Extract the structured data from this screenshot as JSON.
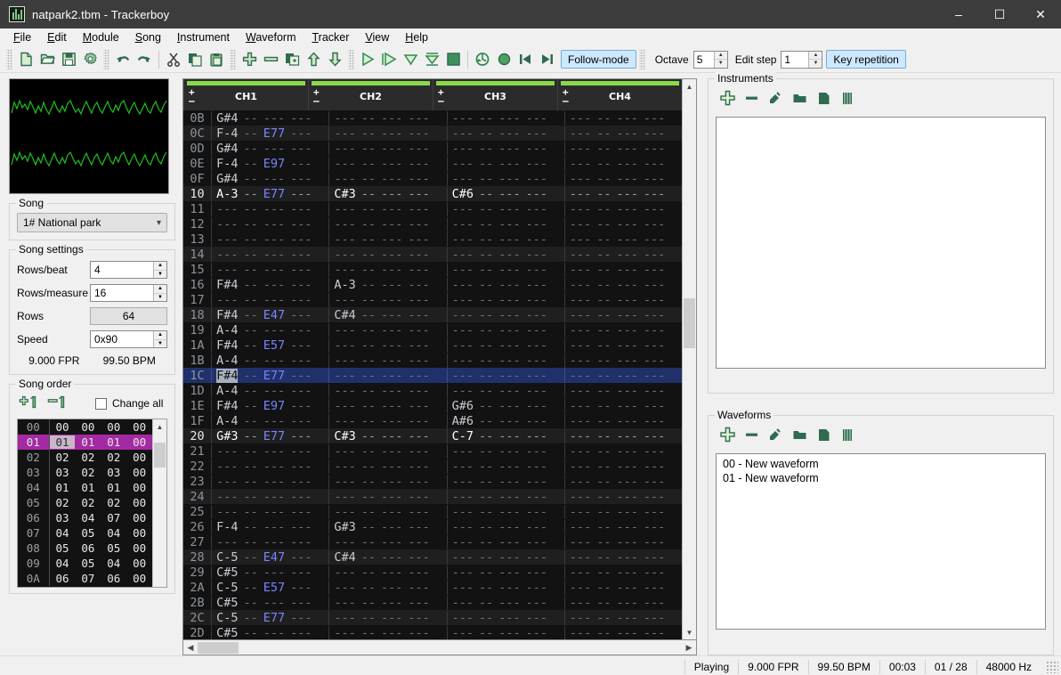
{
  "window": {
    "title": "natpark2.tbm - Trackerboy",
    "app_icon": "trackerboy-icon",
    "minimize": "–",
    "maximize": "☐",
    "close": "✕"
  },
  "menubar": {
    "items": [
      {
        "label": "File",
        "mnemonic": "F"
      },
      {
        "label": "Edit",
        "mnemonic": "E"
      },
      {
        "label": "Module",
        "mnemonic": "M"
      },
      {
        "label": "Song",
        "mnemonic": "S"
      },
      {
        "label": "Instrument",
        "mnemonic": "I"
      },
      {
        "label": "Waveform",
        "mnemonic": "W"
      },
      {
        "label": "Tracker",
        "mnemonic": "T"
      },
      {
        "label": "View",
        "mnemonic": "V"
      },
      {
        "label": "Help",
        "mnemonic": "H"
      }
    ]
  },
  "toolbar": {
    "group_file": [
      "new-icon",
      "open-icon",
      "save-icon",
      "settings-icon"
    ],
    "group_edit": [
      "undo-icon",
      "redo-icon"
    ],
    "group_clipboard": [
      "cut-icon",
      "copy-icon",
      "paste-icon"
    ],
    "group_order": [
      "add-order-icon",
      "remove-order-icon",
      "duplicate-order-icon",
      "move-up-icon",
      "move-down-icon"
    ],
    "group_transport": [
      "play-icon",
      "play-pattern-icon",
      "play-from-cursor-icon",
      "play-row-icon",
      "stop-icon"
    ],
    "group_record": [
      "loop-pattern-icon",
      "record-icon",
      "prev-pattern-icon",
      "next-pattern-icon"
    ],
    "follow_mode_label": "Follow-mode",
    "octave_label": "Octave",
    "octave_value": "5",
    "edit_step_label": "Edit step",
    "edit_step_value": "1",
    "key_repetition_label": "Key repetition"
  },
  "left_dock": {
    "scope_name": "audio-scope",
    "song_group_label": "Song",
    "song_selected": "1# National park",
    "song_settings_label": "Song settings",
    "fields": [
      {
        "label": "Rows/beat",
        "value": "4",
        "type": "spin"
      },
      {
        "label": "Rows/measure",
        "value": "16",
        "type": "spin"
      },
      {
        "label": "Rows",
        "value": "64",
        "type": "readonly"
      },
      {
        "label": "Speed",
        "value": "0x90",
        "type": "spin"
      }
    ],
    "fpr": "9.000 FPR",
    "bpm": "99.50 BPM",
    "song_order_label": "Song order",
    "order_add_icon": "add-order-row-icon",
    "order_remove_icon": "remove-order-row-icon",
    "change_all_label": "Change all",
    "change_all_checked": false,
    "order_rows": [
      {
        "index": "00",
        "cells": [
          "00",
          "00",
          "00",
          "00"
        ]
      },
      {
        "index": "01",
        "cells": [
          "01",
          "01",
          "01",
          "00"
        ]
      },
      {
        "index": "02",
        "cells": [
          "02",
          "02",
          "02",
          "00"
        ]
      },
      {
        "index": "03",
        "cells": [
          "03",
          "02",
          "03",
          "00"
        ]
      },
      {
        "index": "04",
        "cells": [
          "01",
          "01",
          "01",
          "00"
        ]
      },
      {
        "index": "05",
        "cells": [
          "02",
          "02",
          "02",
          "00"
        ]
      },
      {
        "index": "06",
        "cells": [
          "03",
          "04",
          "07",
          "00"
        ]
      },
      {
        "index": "07",
        "cells": [
          "04",
          "05",
          "04",
          "00"
        ]
      },
      {
        "index": "08",
        "cells": [
          "05",
          "06",
          "05",
          "00"
        ]
      },
      {
        "index": "09",
        "cells": [
          "04",
          "05",
          "04",
          "00"
        ]
      },
      {
        "index": "0A",
        "cells": [
          "06",
          "07",
          "06",
          "00"
        ]
      }
    ],
    "order_selected_row": 1,
    "order_selected_cell": 0
  },
  "pattern": {
    "channels": [
      "CH1",
      "CH2",
      "CH3",
      "CH4"
    ],
    "plus_glyph": "+",
    "minus_glyph": "–",
    "cursor_row": "1C",
    "rows": [
      {
        "index": "0B",
        "cells": [
          {
            "note": "G#4"
          },
          {},
          {},
          {}
        ]
      },
      {
        "index": "0C",
        "cells": [
          {
            "note": "F-4",
            "fx": "E77"
          },
          {},
          {},
          {}
        ]
      },
      {
        "index": "0D",
        "cells": [
          {
            "note": "G#4"
          },
          {},
          {},
          {}
        ]
      },
      {
        "index": "0E",
        "cells": [
          {
            "note": "F-4",
            "fx": "E97"
          },
          {},
          {},
          {}
        ]
      },
      {
        "index": "0F",
        "cells": [
          {
            "note": "G#4"
          },
          {},
          {},
          {}
        ]
      },
      {
        "index": "10",
        "cells": [
          {
            "note": "A-3",
            "fx": "E77"
          },
          {
            "note": "C#3"
          },
          {
            "note": "C#6"
          },
          {}
        ]
      },
      {
        "index": "11",
        "cells": [
          {},
          {},
          {},
          {}
        ]
      },
      {
        "index": "12",
        "cells": [
          {},
          {},
          {},
          {}
        ]
      },
      {
        "index": "13",
        "cells": [
          {},
          {},
          {},
          {}
        ]
      },
      {
        "index": "14",
        "cells": [
          {},
          {},
          {},
          {}
        ]
      },
      {
        "index": "15",
        "cells": [
          {},
          {},
          {},
          {}
        ]
      },
      {
        "index": "16",
        "cells": [
          {
            "note": "F#4"
          },
          {
            "note": "A-3"
          },
          {},
          {}
        ]
      },
      {
        "index": "17",
        "cells": [
          {},
          {},
          {},
          {}
        ]
      },
      {
        "index": "18",
        "cells": [
          {
            "note": "F#4",
            "fx": "E47"
          },
          {
            "note": "C#4"
          },
          {},
          {}
        ]
      },
      {
        "index": "19",
        "cells": [
          {
            "note": "A-4"
          },
          {},
          {},
          {}
        ]
      },
      {
        "index": "1A",
        "cells": [
          {
            "note": "F#4",
            "fx": "E57"
          },
          {},
          {},
          {}
        ]
      },
      {
        "index": "1B",
        "cells": [
          {
            "note": "A-4"
          },
          {},
          {},
          {}
        ]
      },
      {
        "index": "1C",
        "cells": [
          {
            "note": "F#4",
            "fx": "E77"
          },
          {},
          {},
          {}
        ]
      },
      {
        "index": "1D",
        "cells": [
          {
            "note": "A-4"
          },
          {},
          {},
          {}
        ]
      },
      {
        "index": "1E",
        "cells": [
          {
            "note": "F#4",
            "fx": "E97"
          },
          {},
          {
            "note": "G#6"
          },
          {}
        ]
      },
      {
        "index": "1F",
        "cells": [
          {
            "note": "A-4"
          },
          {},
          {
            "note": "A#6"
          },
          {}
        ]
      },
      {
        "index": "20",
        "cells": [
          {
            "note": "G#3",
            "fx": "E77"
          },
          {
            "note": "C#3"
          },
          {
            "note": "C-7"
          },
          {}
        ]
      },
      {
        "index": "21",
        "cells": [
          {},
          {},
          {},
          {}
        ]
      },
      {
        "index": "22",
        "cells": [
          {},
          {},
          {},
          {}
        ]
      },
      {
        "index": "23",
        "cells": [
          {},
          {},
          {},
          {}
        ]
      },
      {
        "index": "24",
        "cells": [
          {},
          {},
          {},
          {}
        ]
      },
      {
        "index": "25",
        "cells": [
          {},
          {},
          {},
          {}
        ]
      },
      {
        "index": "26",
        "cells": [
          {
            "note": "F-4"
          },
          {
            "note": "G#3"
          },
          {},
          {}
        ]
      },
      {
        "index": "27",
        "cells": [
          {},
          {},
          {},
          {}
        ]
      },
      {
        "index": "28",
        "cells": [
          {
            "note": "C-5",
            "fx": "E47"
          },
          {
            "note": "C#4"
          },
          {},
          {}
        ]
      },
      {
        "index": "29",
        "cells": [
          {
            "note": "C#5"
          },
          {},
          {},
          {}
        ]
      },
      {
        "index": "2A",
        "cells": [
          {
            "note": "C-5",
            "fx": "E57"
          },
          {},
          {},
          {}
        ]
      },
      {
        "index": "2B",
        "cells": [
          {
            "note": "C#5"
          },
          {},
          {},
          {}
        ]
      },
      {
        "index": "2C",
        "cells": [
          {
            "note": "C-5",
            "fx": "E77"
          },
          {},
          {},
          {}
        ]
      },
      {
        "index": "2D",
        "cells": [
          {
            "note": "C#5"
          },
          {},
          {},
          {}
        ]
      }
    ],
    "empty_note": "---",
    "empty_inst": "--",
    "empty_fx": "---"
  },
  "right_dock": {
    "instruments_label": "Instruments",
    "instruments_icons": [
      "add-icon",
      "remove-icon",
      "rename-icon",
      "open-icon",
      "save-icon",
      "edit-icon"
    ],
    "instruments_items": [],
    "waveforms_label": "Waveforms",
    "waveforms_icons": [
      "add-icon",
      "remove-icon",
      "rename-icon",
      "open-icon",
      "save-icon",
      "edit-icon"
    ],
    "waveforms_items": [
      "00 - New waveform",
      "01 - New waveform"
    ]
  },
  "statusbar": {
    "fields": [
      "Playing",
      "9.000 FPR",
      "99.50 BPM",
      "00:03",
      "01 / 28",
      "48000 Hz"
    ]
  },
  "colors": {
    "accent_green": "#2f6b4f",
    "vu_green": "#8bd94b",
    "scope_green": "#1fc11f",
    "cursor_row": "#20306a",
    "order_selection": "#a32aa3",
    "fx_blue": "#7a84ff",
    "toggle_blue": "#cde8ff"
  }
}
